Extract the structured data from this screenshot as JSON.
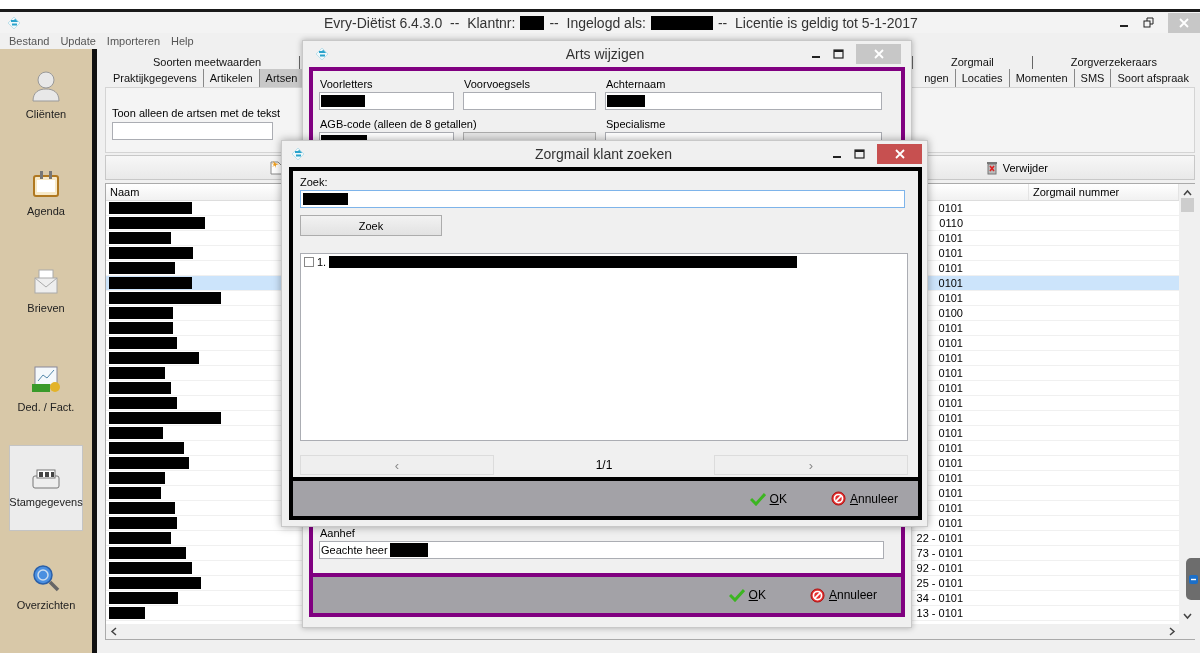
{
  "window": {
    "title": [
      {
        "kind": "text",
        "text": "Evry-Diëtist 6.4.3.0  --  Klantnr:"
      },
      {
        "kind": "redacted"
      },
      {
        "kind": "text",
        "text": "--  Ingelogd als:"
      },
      {
        "kind": "redacted"
      },
      {
        "kind": "text",
        "text": "--  Licentie is geldig tot 5-1-2017"
      }
    ]
  },
  "menu": [
    "Bestand",
    "Update",
    "Importeren",
    "Help"
  ],
  "sidebar": {
    "items": [
      {
        "label": "Cliënten",
        "selected": false
      },
      {
        "label": "Agenda",
        "selected": false
      },
      {
        "label": "Brieven",
        "selected": false
      },
      {
        "label": "Ded. / Fact.",
        "selected": false
      },
      {
        "label": "Stamgegevens",
        "selected": true
      },
      {
        "label": "Overzichten",
        "selected": false
      }
    ]
  },
  "tabs": {
    "row_1": [
      {
        "label": "Soorten meetwaarden",
        "selected": false
      },
      {
        "label": "Zorgmail",
        "selected": false
      },
      {
        "label": "Zorgverzekeraars",
        "selected": false
      }
    ],
    "row_2": [
      {
        "label": "Praktijkgegevens",
        "selected": false
      },
      {
        "label": "Artikelen",
        "selected": false
      },
      {
        "label": "Artsen",
        "selected": true
      },
      {
        "label": "ngen",
        "selected": false
      },
      {
        "label": "Locaties",
        "selected": false
      },
      {
        "label": "Momenten",
        "selected": false
      },
      {
        "label": "SMS",
        "selected": false
      },
      {
        "label": "Soort afspraak",
        "selected": false
      }
    ]
  },
  "filter": {
    "label": "Toon alleen de artsen met de tekst"
  },
  "toolbar": {
    "delete": "Verwijder"
  },
  "table": {
    "columns": [
      "Naam",
      "Zorgmail nummer"
    ],
    "rows": [
      {
        "redacted": true,
        "code": "0101",
        "selected": false
      },
      {
        "redacted": true,
        "code": "0110",
        "selected": false
      },
      {
        "redacted": true,
        "code": "0101",
        "selected": false
      },
      {
        "redacted": true,
        "code": "0101",
        "selected": false
      },
      {
        "redacted": true,
        "code": "0101",
        "selected": false
      },
      {
        "redacted": true,
        "code": "0101",
        "selected": true
      },
      {
        "redacted": true,
        "code": "0101",
        "selected": false
      },
      {
        "redacted": true,
        "code": "0100",
        "selected": false
      },
      {
        "redacted": true,
        "code": "0101",
        "selected": false
      },
      {
        "redacted": true,
        "code": "0101",
        "selected": false
      },
      {
        "redacted": true,
        "code": "0101",
        "selected": false
      },
      {
        "redacted": true,
        "code": "0101",
        "selected": false
      },
      {
        "redacted": true,
        "code": "0101",
        "selected": false
      },
      {
        "redacted": true,
        "code": "0101",
        "selected": false
      },
      {
        "redacted": true,
        "code": "0101",
        "selected": false
      },
      {
        "redacted": true,
        "code": "0101",
        "selected": false
      },
      {
        "redacted": true,
        "code": "0101",
        "selected": false
      },
      {
        "redacted": true,
        "code": "0101",
        "selected": false
      },
      {
        "redacted": true,
        "code": "0101",
        "selected": false
      },
      {
        "redacted": true,
        "code": "0101",
        "selected": false
      },
      {
        "redacted": true,
        "code": "0101",
        "selected": false
      },
      {
        "redacted": true,
        "code": "0101",
        "selected": false
      },
      {
        "redacted": true,
        "code": "22 - 0101",
        "selected": false
      },
      {
        "redacted": true,
        "code": "73 - 0101",
        "selected": false
      },
      {
        "redacted": true,
        "code": "92 - 0101",
        "selected": false
      },
      {
        "redacted": true,
        "code": "25 - 0101",
        "selected": false
      },
      {
        "redacted": true,
        "code": "34 - 0101",
        "selected": false
      },
      {
        "redacted": true,
        "code": "13 - 0101",
        "selected": false
      }
    ]
  },
  "arts_dialog": {
    "title": "Arts wijzigen",
    "fields": [
      {
        "label": "Voorletters",
        "redacted": true
      },
      {
        "label": "Voorvoegsels",
        "redacted": false
      },
      {
        "label": "Achternaam",
        "redacted": true
      }
    ],
    "agb_label": "AGB-code (alleen de 8 getallen)",
    "agb_redacted": true,
    "specialisme_label": "Specialisme",
    "aanhef_label": "Aanhef",
    "aanhef_value": [
      {
        "kind": "text",
        "text": "Geachte heer"
      },
      {
        "kind": "redacted"
      }
    ],
    "ok": "OK",
    "cancel": "Annuleer"
  },
  "zorgmail_dialog": {
    "title": "Zorgmail klant zoeken",
    "search_label": "Zoek:",
    "search_redacted": true,
    "search_button": "Zoek",
    "results": [
      {
        "number": "1.",
        "checked": false,
        "redacted": true
      }
    ],
    "prev": "‹",
    "page": "1/1",
    "next": "›",
    "ok": "OK",
    "cancel": "Annuleer"
  }
}
